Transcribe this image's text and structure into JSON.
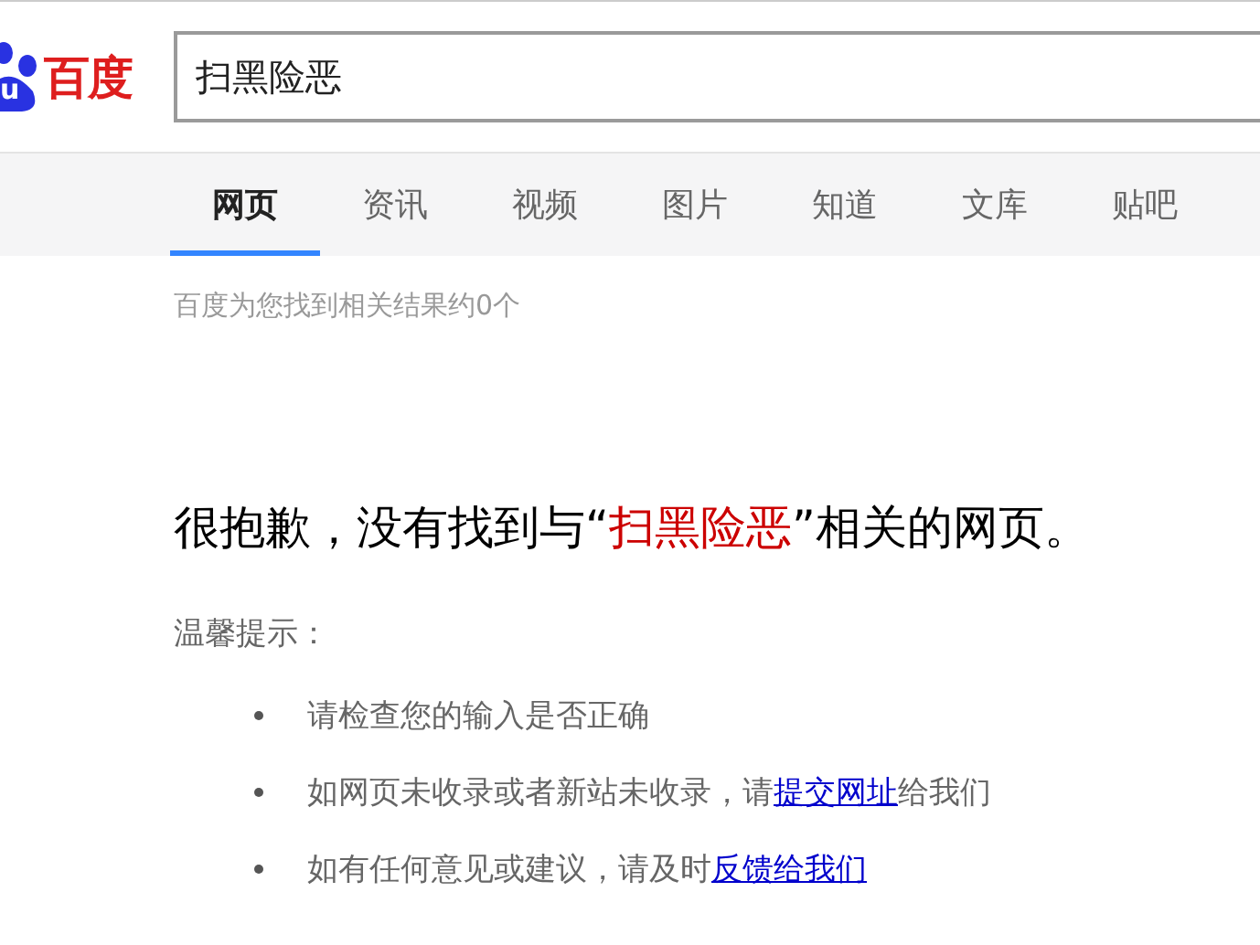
{
  "logo": {
    "mark": "u",
    "name": "百度"
  },
  "search": {
    "value": "扫黑险恶"
  },
  "tabs": [
    {
      "label": "网页",
      "selected": true
    },
    {
      "label": "资讯",
      "selected": false
    },
    {
      "label": "视频",
      "selected": false
    },
    {
      "label": "图片",
      "selected": false
    },
    {
      "label": "知道",
      "selected": false
    },
    {
      "label": "文库",
      "selected": false
    },
    {
      "label": "贴吧",
      "selected": false
    }
  ],
  "result_count": "百度为您找到相关结果约0个",
  "headline": {
    "before": "很抱歉，没有找到与",
    "open_quote": "“",
    "query": "扫黑险恶",
    "close_quote": "”",
    "after": "相关的网页。"
  },
  "tips_title": "温馨提示：",
  "tips": [
    {
      "parts": [
        {
          "kind": "text",
          "text": "请检查您的输入是否正确"
        }
      ]
    },
    {
      "parts": [
        {
          "kind": "text",
          "text": "如网页未收录或者新站未收录，请"
        },
        {
          "kind": "link",
          "text": "提交网址"
        },
        {
          "kind": "text",
          "text": "给我们"
        }
      ]
    },
    {
      "parts": [
        {
          "kind": "text",
          "text": "如有任何意见或建议，请及时"
        },
        {
          "kind": "link",
          "text": "反馈给我们"
        }
      ]
    }
  ]
}
